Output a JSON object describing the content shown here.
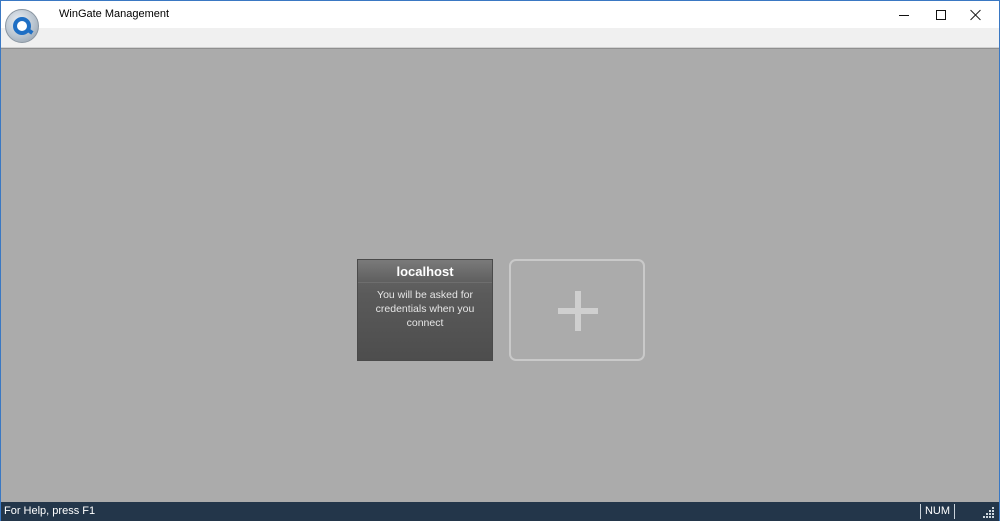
{
  "window": {
    "title": "WinGate Management"
  },
  "main": {
    "server_card": {
      "title": "localhost",
      "description": "You will be asked for credentials when you connect"
    },
    "add_card": {
      "icon": "plus-icon"
    }
  },
  "statusbar": {
    "help_text": "For Help, press F1",
    "num_indicator": "NUM"
  },
  "colors": {
    "content_bg": "#ababab",
    "status_bg": "#23364a",
    "accent": "#1f6fc4"
  }
}
